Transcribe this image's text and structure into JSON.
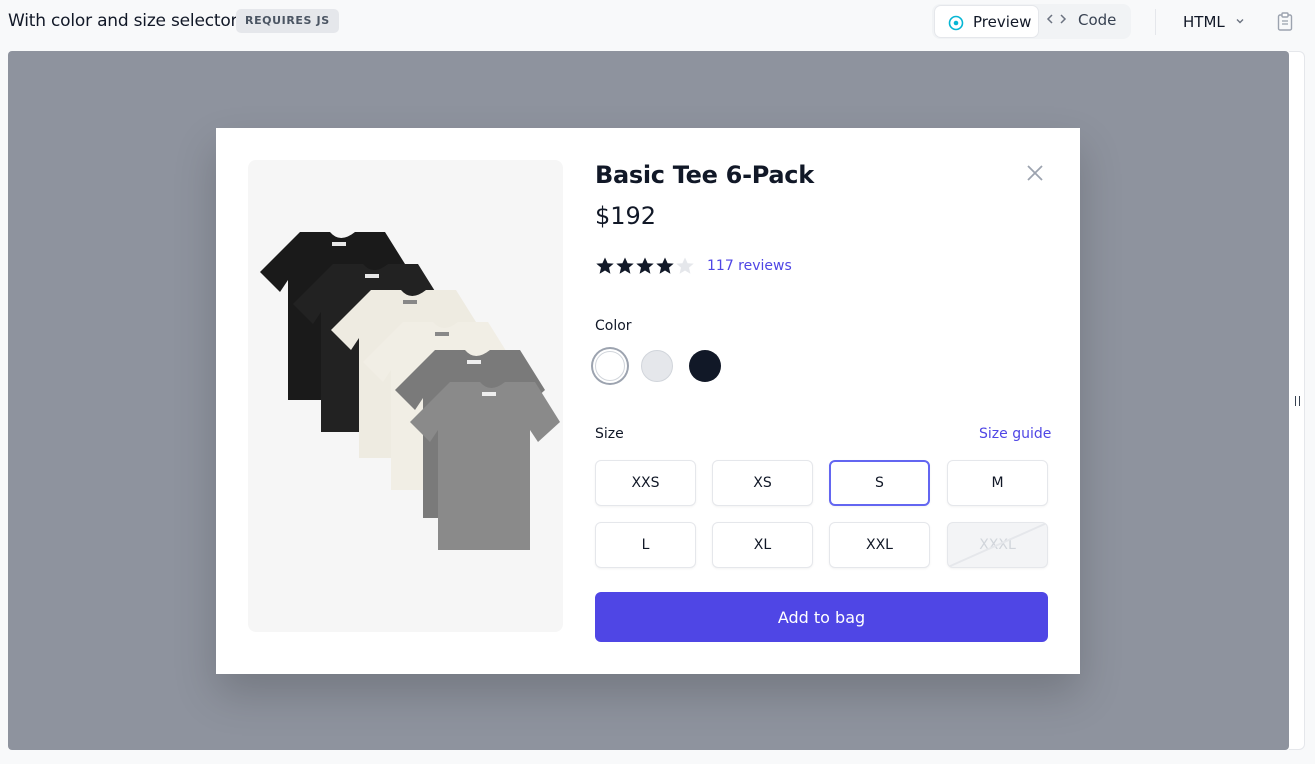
{
  "topbar": {
    "title": "With color and size selector",
    "badge": "REQUIRES JS",
    "tabs": [
      {
        "label": "Preview",
        "icon": "eye-icon",
        "active": true
      },
      {
        "label": "Code",
        "icon": "code-icon",
        "active": false
      }
    ],
    "language": "HTML",
    "copy_icon": "clipboard-icon"
  },
  "product": {
    "name": "Basic Tee 6-Pack",
    "price": "$192",
    "rating": 4,
    "rating_max": 5,
    "reviews_link": "117 reviews",
    "image": "six stacked t-shirts: black, cream, heather gray"
  },
  "color": {
    "label": "Color",
    "options": [
      {
        "name": "White",
        "hex": "#ffffff",
        "selected": true
      },
      {
        "name": "Gray",
        "hex": "#e5e7eb",
        "selected": false
      },
      {
        "name": "Black",
        "hex": "#111827",
        "selected": false
      }
    ]
  },
  "size": {
    "label": "Size",
    "guide_link": "Size guide",
    "options": [
      {
        "label": "XXS",
        "available": true,
        "selected": false
      },
      {
        "label": "XS",
        "available": true,
        "selected": false
      },
      {
        "label": "S",
        "available": true,
        "selected": true
      },
      {
        "label": "M",
        "available": true,
        "selected": false
      },
      {
        "label": "L",
        "available": true,
        "selected": false
      },
      {
        "label": "XL",
        "available": true,
        "selected": false
      },
      {
        "label": "XXL",
        "available": true,
        "selected": false
      },
      {
        "label": "XXXL",
        "available": false,
        "selected": false
      }
    ]
  },
  "actions": {
    "add_to_bag": "Add to bag",
    "close_icon": "close-icon"
  },
  "colors": {
    "accent": "#4f46e5",
    "selected_ring": "#6366f1",
    "backdrop": "#8e939e",
    "star_filled": "#111827",
    "star_empty": "#e5e7eb"
  }
}
